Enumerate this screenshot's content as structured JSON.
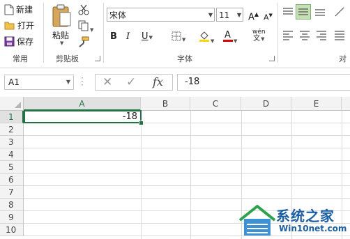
{
  "ribbon": {
    "new_label": "新建",
    "open_label": "打开",
    "save_label": "保存",
    "group_common": "常用",
    "paste_label": "粘贴",
    "group_clipboard": "剪贴板",
    "font_name": "宋体",
    "font_size": "11",
    "bold": "B",
    "italic": "I",
    "underline": "U",
    "font_color_glyph": "A",
    "grow_font_glyph": "A",
    "shrink_font_glyph": "A",
    "phonetic_glyph": "wén",
    "phonetic_sub": "文",
    "group_font": "字体",
    "group_align_partial": "对",
    "accent_color": "#217346",
    "font_color_bar": "#e00000",
    "fill_color_bar": "#ffd700"
  },
  "formula_bar": {
    "name_box": "A1",
    "cancel_icon": "✕",
    "enter_icon": "✓",
    "fx": "fx",
    "value": "-18"
  },
  "sheet": {
    "columns": [
      "A",
      "B",
      "C",
      "D",
      "E"
    ],
    "rows": [
      "1",
      "2",
      "3",
      "4",
      "5",
      "6",
      "7",
      "8",
      "9",
      "10"
    ],
    "active_cell_value": "-18"
  },
  "watermark": {
    "title": "系统之家",
    "url": "Win10net.com"
  }
}
